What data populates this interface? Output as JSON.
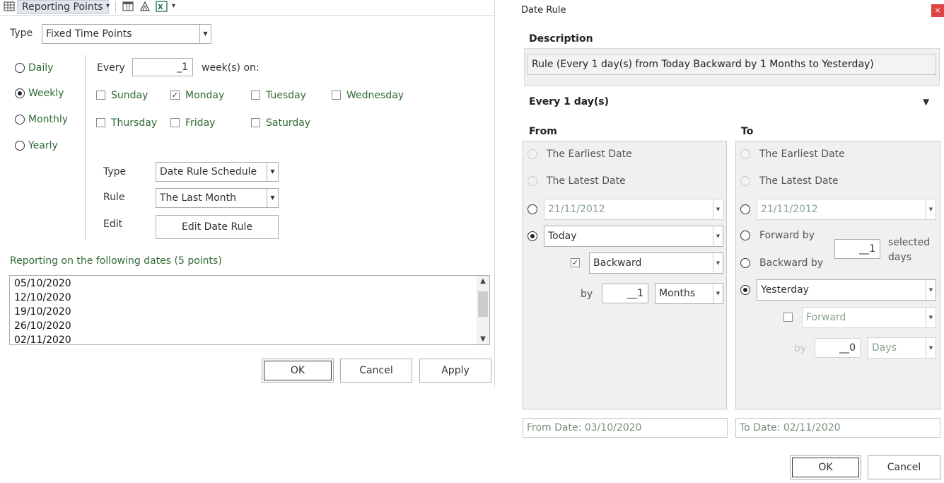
{
  "left_dialog": {
    "toolbar": {
      "title": "Reporting Points",
      "dropdown_glyph": "▾",
      "icons": [
        "grid-icon",
        "table-icon",
        "chart-icon",
        "excel-icon"
      ]
    },
    "type_label": "Type",
    "type_value": "Fixed Time Points",
    "frequency": {
      "options": [
        "Daily",
        "Weekly",
        "Monthly",
        "Yearly"
      ],
      "selected": "Weekly"
    },
    "every_label": "Every",
    "every_value": "_1",
    "weeks_on_label": "week(s) on:",
    "days": [
      {
        "label": "Sunday",
        "checked": false
      },
      {
        "label": "Monday",
        "checked": true
      },
      {
        "label": "Tuesday",
        "checked": false
      },
      {
        "label": "Wednesday",
        "checked": false
      },
      {
        "label": "Thursday",
        "checked": false
      },
      {
        "label": "Friday",
        "checked": false
      },
      {
        "label": "Saturday",
        "checked": false
      }
    ],
    "schedule_type_label": "Type",
    "schedule_type_value": "Date Rule Schedule",
    "rule_label": "Rule",
    "rule_value": "The Last Month",
    "edit_label": "Edit",
    "edit_button": "Edit Date Rule",
    "dates_heading": "Reporting on the following dates (5 points)",
    "dates": [
      "05/10/2020",
      "12/10/2020",
      "19/10/2020",
      "26/10/2020",
      "02/11/2020"
    ],
    "buttons": {
      "ok": "OK",
      "cancel": "Cancel",
      "apply": "Apply"
    }
  },
  "right_dialog": {
    "title": "Date Rule",
    "close_glyph": "×",
    "description_label": "Description",
    "description_value": "Rule (Every 1 day(s) from Today Backward by 1 Months to Yesterday)",
    "section_label": "Every 1 day(s)",
    "from": {
      "label": "From",
      "earliest": "The Earliest Date",
      "latest": "The Latest Date",
      "date_value": "21/11/2012",
      "relative_value": "Today",
      "direction_checked": true,
      "direction_value": "Backward",
      "by_label": "by",
      "by_value": "__1",
      "unit_value": "Months",
      "selected": "relative"
    },
    "to": {
      "label": "To",
      "earliest": "The Earliest Date",
      "latest": "The Latest Date",
      "date_value": "21/11/2012",
      "forward_by": "Forward by",
      "backward_by": "Backward by",
      "selected_days_value": "__1",
      "selected_label": "selected",
      "days_label": "days",
      "relative_value": "Yesterday",
      "direction_checked": false,
      "direction_value": "Forward",
      "by_label": "by",
      "by_value": "__0",
      "unit_value": "Days",
      "selected": "relative"
    },
    "from_date": "From Date: 03/10/2020",
    "to_date": "To Date: 02/11/2020",
    "buttons": {
      "ok": "OK",
      "cancel": "Cancel"
    }
  }
}
